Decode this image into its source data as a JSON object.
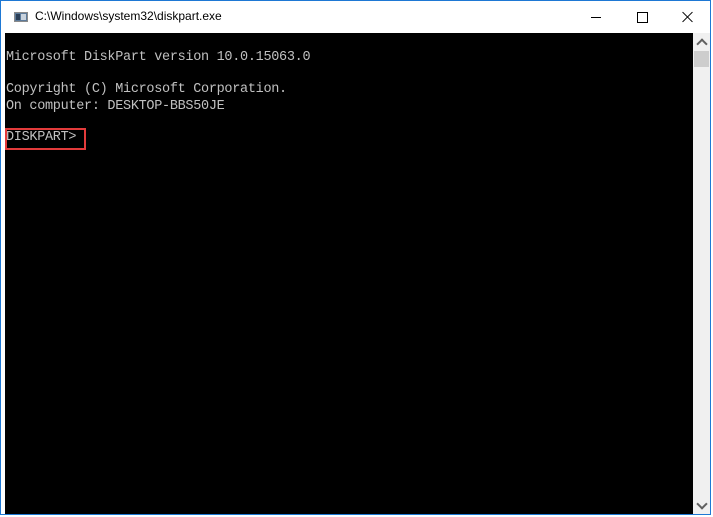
{
  "window": {
    "title": "C:\\Windows\\system32\\diskpart.exe",
    "app_icon": "console-app-icon",
    "controls": {
      "minimize": "minimize-icon",
      "maximize": "maximize-icon",
      "close": "close-icon"
    }
  },
  "console": {
    "lines": [
      "Microsoft DiskPart version 10.0.15063.0",
      "",
      "Copyright (C) Microsoft Corporation.",
      "On computer: DESKTOP-BBS50JE",
      "",
      "DISKPART>"
    ],
    "highlight_color": "#e33b3b",
    "text_color": "#c0c0c0",
    "background_color": "#000000"
  },
  "scrollbar": {
    "up_icon": "chevron-up-icon",
    "down_icon": "chevron-down-icon"
  }
}
